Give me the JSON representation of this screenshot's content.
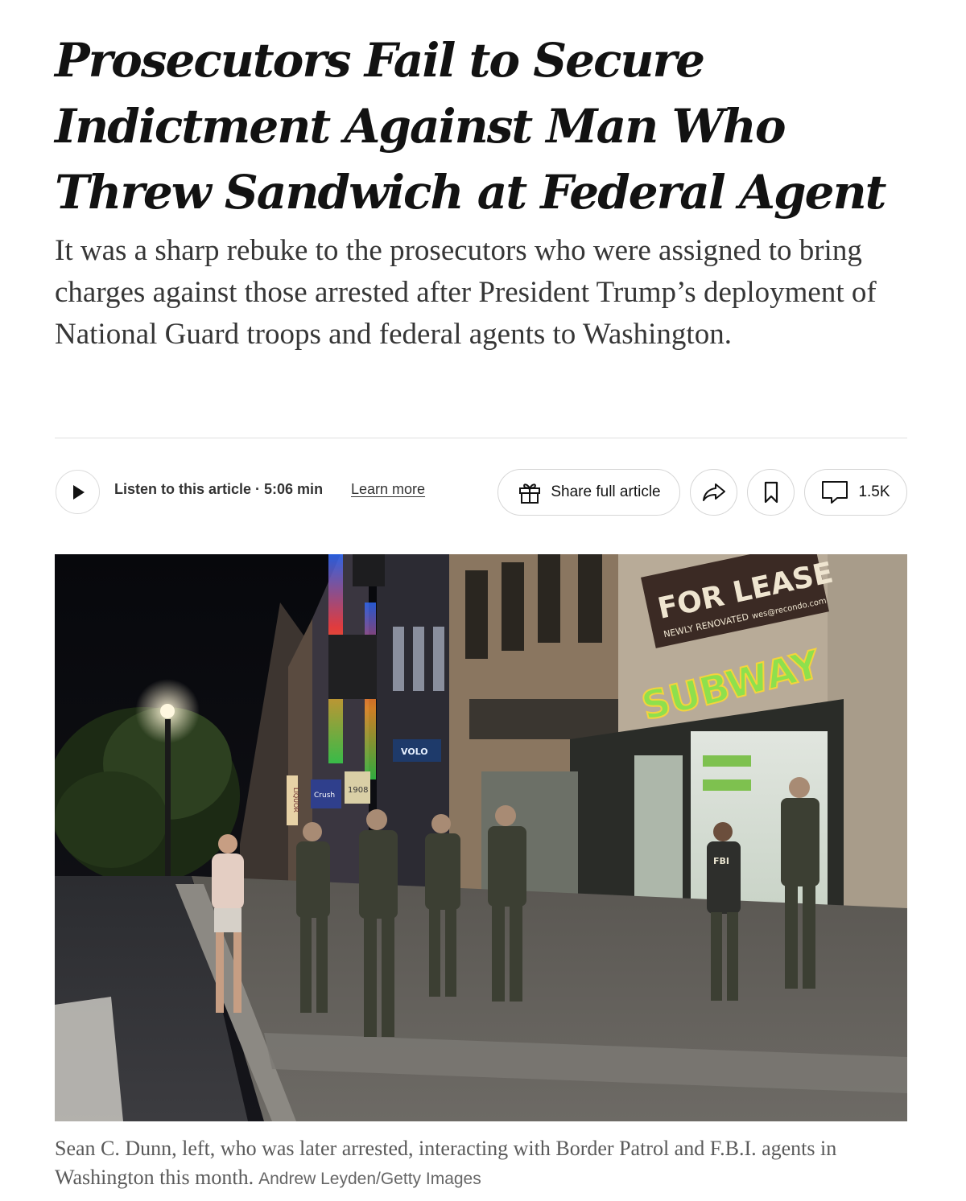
{
  "article": {
    "headline": "Prosecutors Fail to Secure Indictment Against Man Who Threw Sandwich at Federal Agent",
    "summary": "It was a sharp rebuke to the prosecutors who were assigned to bring charges against those arrested after President Trump’s deployment of National Guard troops and federal agents to Washington."
  },
  "toolbar": {
    "listen_label": "Listen to this article · 5:06 min",
    "learn_more": "Learn more",
    "share_full_label": "Share full article",
    "comment_count": "1.5K",
    "icons": {
      "play": "play-icon",
      "gift": "gift-icon",
      "share": "share-arrow-icon",
      "bookmark": "bookmark-icon",
      "comment": "comment-icon"
    }
  },
  "photo": {
    "signs": {
      "subway": "SUBWAY",
      "lease": "FOR LEASE",
      "lease_sub": "NEWLY RENOVATED",
      "lease_site": "wes@recondo.com",
      "volo": "VOLO",
      "crush": "Crush",
      "liquor": "LIQUOR",
      "address": "1908",
      "fbi": "FBI"
    }
  },
  "caption": {
    "text": "Sean C. Dunn, left, who was later arrested, interacting with Border Patrol and F.B.I. agents in Washington this month.",
    "credit": "Andrew Leyden/Getty Images"
  },
  "colors": {
    "text": "#121212",
    "summary": "#363636",
    "caption": "#5a5a5a",
    "border": "#d6d6d6",
    "subway_green": "#8ee04d",
    "subway_yellow": "#f4d33d"
  }
}
